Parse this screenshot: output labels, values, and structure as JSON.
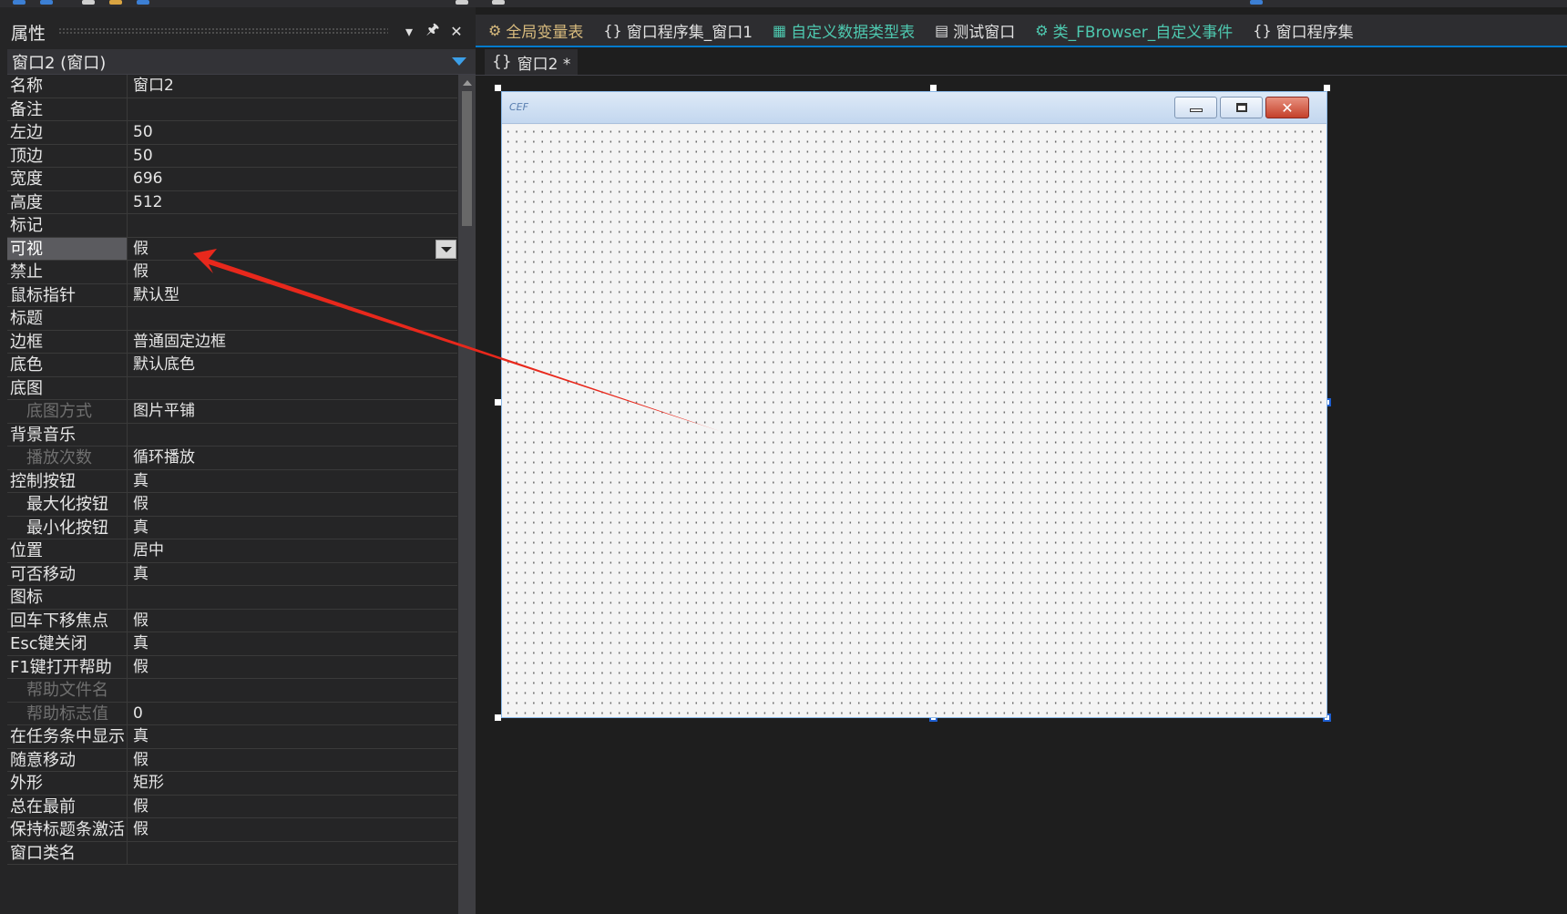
{
  "properties_panel": {
    "title": "属性",
    "pin_glyph": "🖈",
    "close_glyph": "✕",
    "selected_object": "窗口2 (窗口)",
    "rows": [
      {
        "name": "名称",
        "value": "窗口2"
      },
      {
        "name": "备注",
        "value": ""
      },
      {
        "name": "左边",
        "value": "50"
      },
      {
        "name": "顶边",
        "value": "50"
      },
      {
        "name": "宽度",
        "value": "696"
      },
      {
        "name": "高度",
        "value": "512"
      },
      {
        "name": "标记",
        "value": ""
      },
      {
        "name": "可视",
        "value": "假"
      },
      {
        "name": "禁止",
        "value": "假"
      },
      {
        "name": "鼠标指针",
        "value": "默认型"
      },
      {
        "name": "标题",
        "value": ""
      },
      {
        "name": "边框",
        "value": "普通固定边框"
      },
      {
        "name": "底色",
        "value": "默认底色"
      },
      {
        "name": "底图",
        "value": ""
      },
      {
        "name": "底图方式",
        "value": "图片平铺"
      },
      {
        "name": "背景音乐",
        "value": ""
      },
      {
        "name": "播放次数",
        "value": "循环播放"
      },
      {
        "name": "控制按钮",
        "value": "真"
      },
      {
        "name": "最大化按钮",
        "value": "假"
      },
      {
        "name": "最小化按钮",
        "value": "真"
      },
      {
        "name": "位置",
        "value": "居中"
      },
      {
        "name": "可否移动",
        "value": "真"
      },
      {
        "name": "图标",
        "value": ""
      },
      {
        "name": "回车下移焦点",
        "value": "假"
      },
      {
        "name": "Esc键关闭",
        "value": "真"
      },
      {
        "name": "F1键打开帮助",
        "value": "假"
      },
      {
        "name": "帮助文件名",
        "value": ""
      },
      {
        "name": "帮助标志值",
        "value": "0"
      },
      {
        "name": "在任务条中显示",
        "value": "真"
      },
      {
        "name": "随意移动",
        "value": "假"
      },
      {
        "name": "外形",
        "value": "矩形"
      },
      {
        "name": "总在最前",
        "value": "假"
      },
      {
        "name": "保持标题条激活",
        "value": "假"
      },
      {
        "name": "窗口类名",
        "value": ""
      }
    ]
  },
  "editor": {
    "tabs": [
      {
        "label": "全局变量表",
        "icon": "⚙"
      },
      {
        "label": "窗口程序集_窗口1",
        "icon": "{}"
      },
      {
        "label": "自定义数据类型表",
        "icon": "▦"
      },
      {
        "label": "测试窗口",
        "icon": "▤"
      },
      {
        "label": "类_FBrowser_自定义事件",
        "icon": "⚙"
      },
      {
        "label": "窗口程序集",
        "icon": "{}"
      }
    ],
    "sub_tab": {
      "icon": "{}",
      "label": "窗口2 *"
    },
    "form": {
      "logo_text": "CEF",
      "close_glyph": "✕"
    }
  },
  "colors": {
    "background": "#1e1e1e",
    "panel": "#252526",
    "accent": "#007acc",
    "annotation_arrow": "#e8281c"
  }
}
